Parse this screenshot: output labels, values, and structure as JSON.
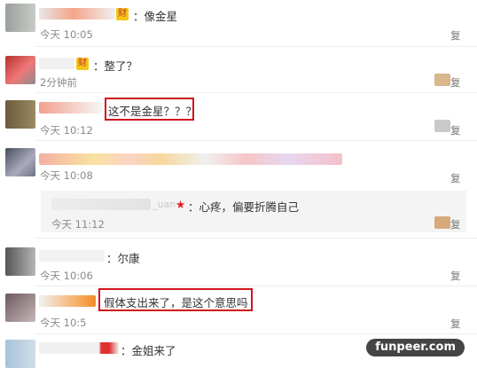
{
  "comments": [
    {
      "text": "：像金星",
      "badge": "财",
      "time": "今天 10:05",
      "reply_label": "复"
    },
    {
      "text": "：整了？",
      "badge": "财",
      "time": "2分钟前",
      "reply_label": "复"
    },
    {
      "text": "这不是金星？？？",
      "time": "今天 10:12",
      "reply_label": "复"
    },
    {
      "text": "",
      "time": "今天 10:08",
      "reply_label": "复"
    },
    {
      "text": "：尔康",
      "time": "今天 10:06",
      "reply_label": "复"
    },
    {
      "text": "假体支出来了，是这个意思吗",
      "time": "今天 10:5",
      "reply_label": "复"
    },
    {
      "text": "：金姐来了",
      "time": "",
      "reply_label": ""
    }
  ],
  "subreply": {
    "name_suffix": "_uan",
    "star": "★",
    "text": "：心疼，偏要折腾自己",
    "time": "今天 11:12",
    "reply_label": "复"
  },
  "watermark": "funpeer.com",
  "colors": {
    "highlight_border": "#d0151c",
    "time_text": "#8a8a8a",
    "badge_bg": "#f5c518"
  }
}
